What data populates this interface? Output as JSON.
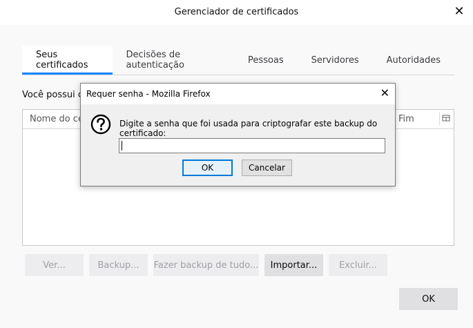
{
  "window": {
    "title": "Gerenciador de certificados",
    "close_glyph": "✕"
  },
  "tabs": [
    {
      "label": "Seus certificados",
      "selected": true
    },
    {
      "label": "Decisões de autenticação",
      "selected": false
    },
    {
      "label": "Pessoas",
      "selected": false
    },
    {
      "label": "Servidores",
      "selected": false
    },
    {
      "label": "Autoridades",
      "selected": false
    }
  ],
  "description": "Você possui ce",
  "tree": {
    "columns": {
      "name": "Nome do ce",
      "end": "Fim"
    }
  },
  "buttons": {
    "view": "Ver...",
    "backup": "Backup...",
    "backup_all": "Fazer backup de tudo...",
    "import": "Importar...",
    "delete": "Excluir...",
    "ok": "OK"
  },
  "modal": {
    "title": "Requer senha - Mozilla Firefox",
    "close_glyph": "✕",
    "prompt": "Digite a senha que foi usada para criptografar este backup do certificado:",
    "password_value": "",
    "ok_label": "OK",
    "cancel_label": "Cancelar"
  },
  "colors": {
    "accent": "#0a84ff",
    "modal_default_border": "#0078d7"
  }
}
